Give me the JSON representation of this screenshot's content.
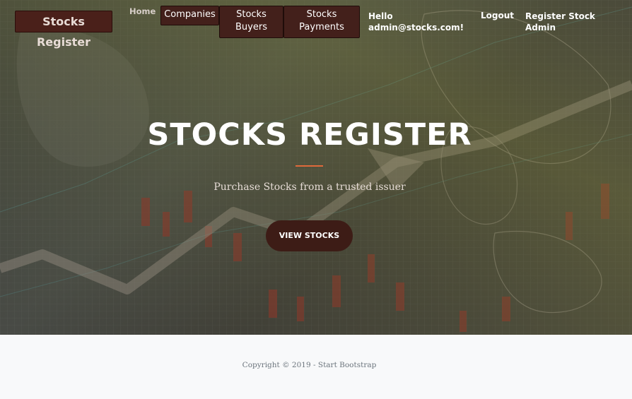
{
  "navbar": {
    "brand": "Stocks Register",
    "home_label": "Home",
    "companies_label": "Companies",
    "buyers_label_line1": "Stocks",
    "buyers_label_line2": "Buyers",
    "payments_label_line1": "Stocks",
    "payments_label_line2": "Payments",
    "hello_line1": "Hello",
    "hello_line2": "admin@stocks.com!",
    "logout_label": "Logout",
    "register_line1": "Register Stock",
    "register_line2": "Admin"
  },
  "hero": {
    "title": "STOCKS REGISTER",
    "subtitle": "Purchase Stocks from a trusted issuer",
    "cta_label": "VIEW STOCKS"
  },
  "footer": {
    "copyright": "Copyright © 2019 - Start Bootstrap"
  },
  "colors": {
    "brand_bg": "#4a201a",
    "divider": "#e06a3b",
    "cta_bg": "#3d1c16",
    "footer_bg": "#f8f9fa"
  }
}
